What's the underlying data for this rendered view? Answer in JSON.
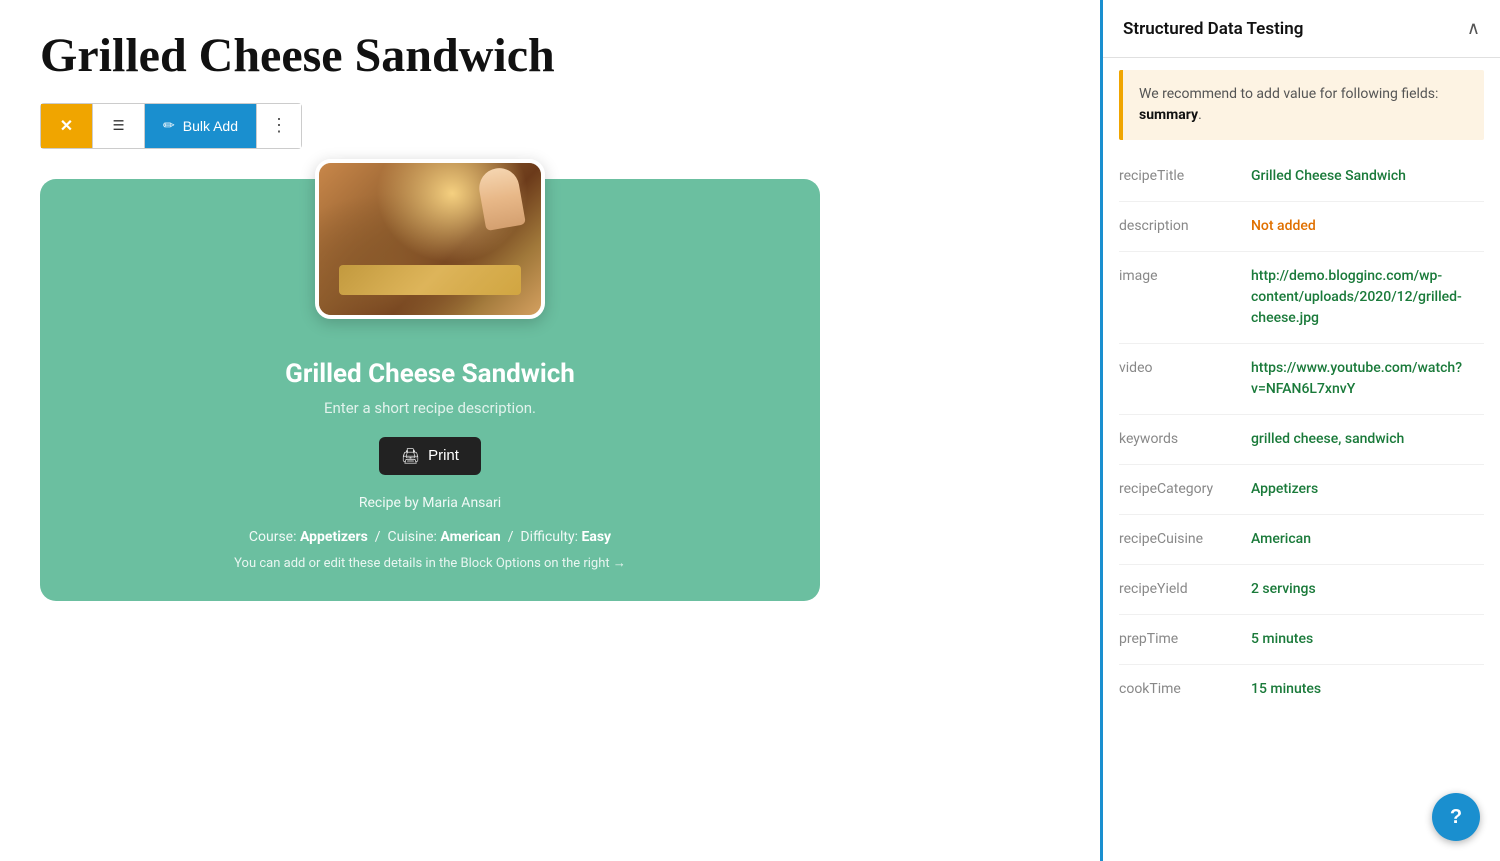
{
  "page": {
    "title": "Grilled Cheese Sandwich"
  },
  "toolbar": {
    "excel_icon": "✕",
    "list_icon": "☰",
    "bulk_add_label": "Bulk Add",
    "more_icon": "⋮"
  },
  "recipe_card": {
    "title": "Grilled Cheese Sandwich",
    "description": "Enter a short recipe description.",
    "print_label": "Print",
    "author": "Recipe by Maria Ansari",
    "course_label": "Course:",
    "course_value": "Appetizers",
    "cuisine_label": "Cuisine:",
    "cuisine_value": "American",
    "difficulty_label": "Difficulty:",
    "difficulty_value": "Easy",
    "note": "You can add or edit these details in the Block Options on the right →"
  },
  "right_panel": {
    "title": "Structured Data Testing",
    "collapse_icon": "∧",
    "recommendation": {
      "text": "We recommend to add value for following fields: ",
      "field": "summary",
      "period": "."
    },
    "fields": [
      {
        "key": "recipeTitle",
        "value": "Grilled Cheese Sandwich",
        "color": "green"
      },
      {
        "key": "description",
        "value": "Not added",
        "color": "orange"
      },
      {
        "key": "image",
        "value": "http://demo.blogginc.com/wp-content/uploads/2020/12/grilled-cheese.jpg",
        "color": "green"
      },
      {
        "key": "video",
        "value": "https://www.youtube.com/watch?v=NFAN6L7xnvY",
        "color": "green"
      },
      {
        "key": "keywords",
        "value": "grilled cheese, sandwich",
        "color": "green"
      },
      {
        "key": "recipeCategory",
        "value": "Appetizers",
        "color": "green"
      },
      {
        "key": "recipeCuisine",
        "value": "American",
        "color": "green"
      },
      {
        "key": "recipeYield",
        "value": "2 servings",
        "color": "green"
      },
      {
        "key": "prepTime",
        "value": "5 minutes",
        "color": "green"
      },
      {
        "key": "cookTime",
        "value": "15 minutes",
        "color": "green"
      }
    ]
  }
}
